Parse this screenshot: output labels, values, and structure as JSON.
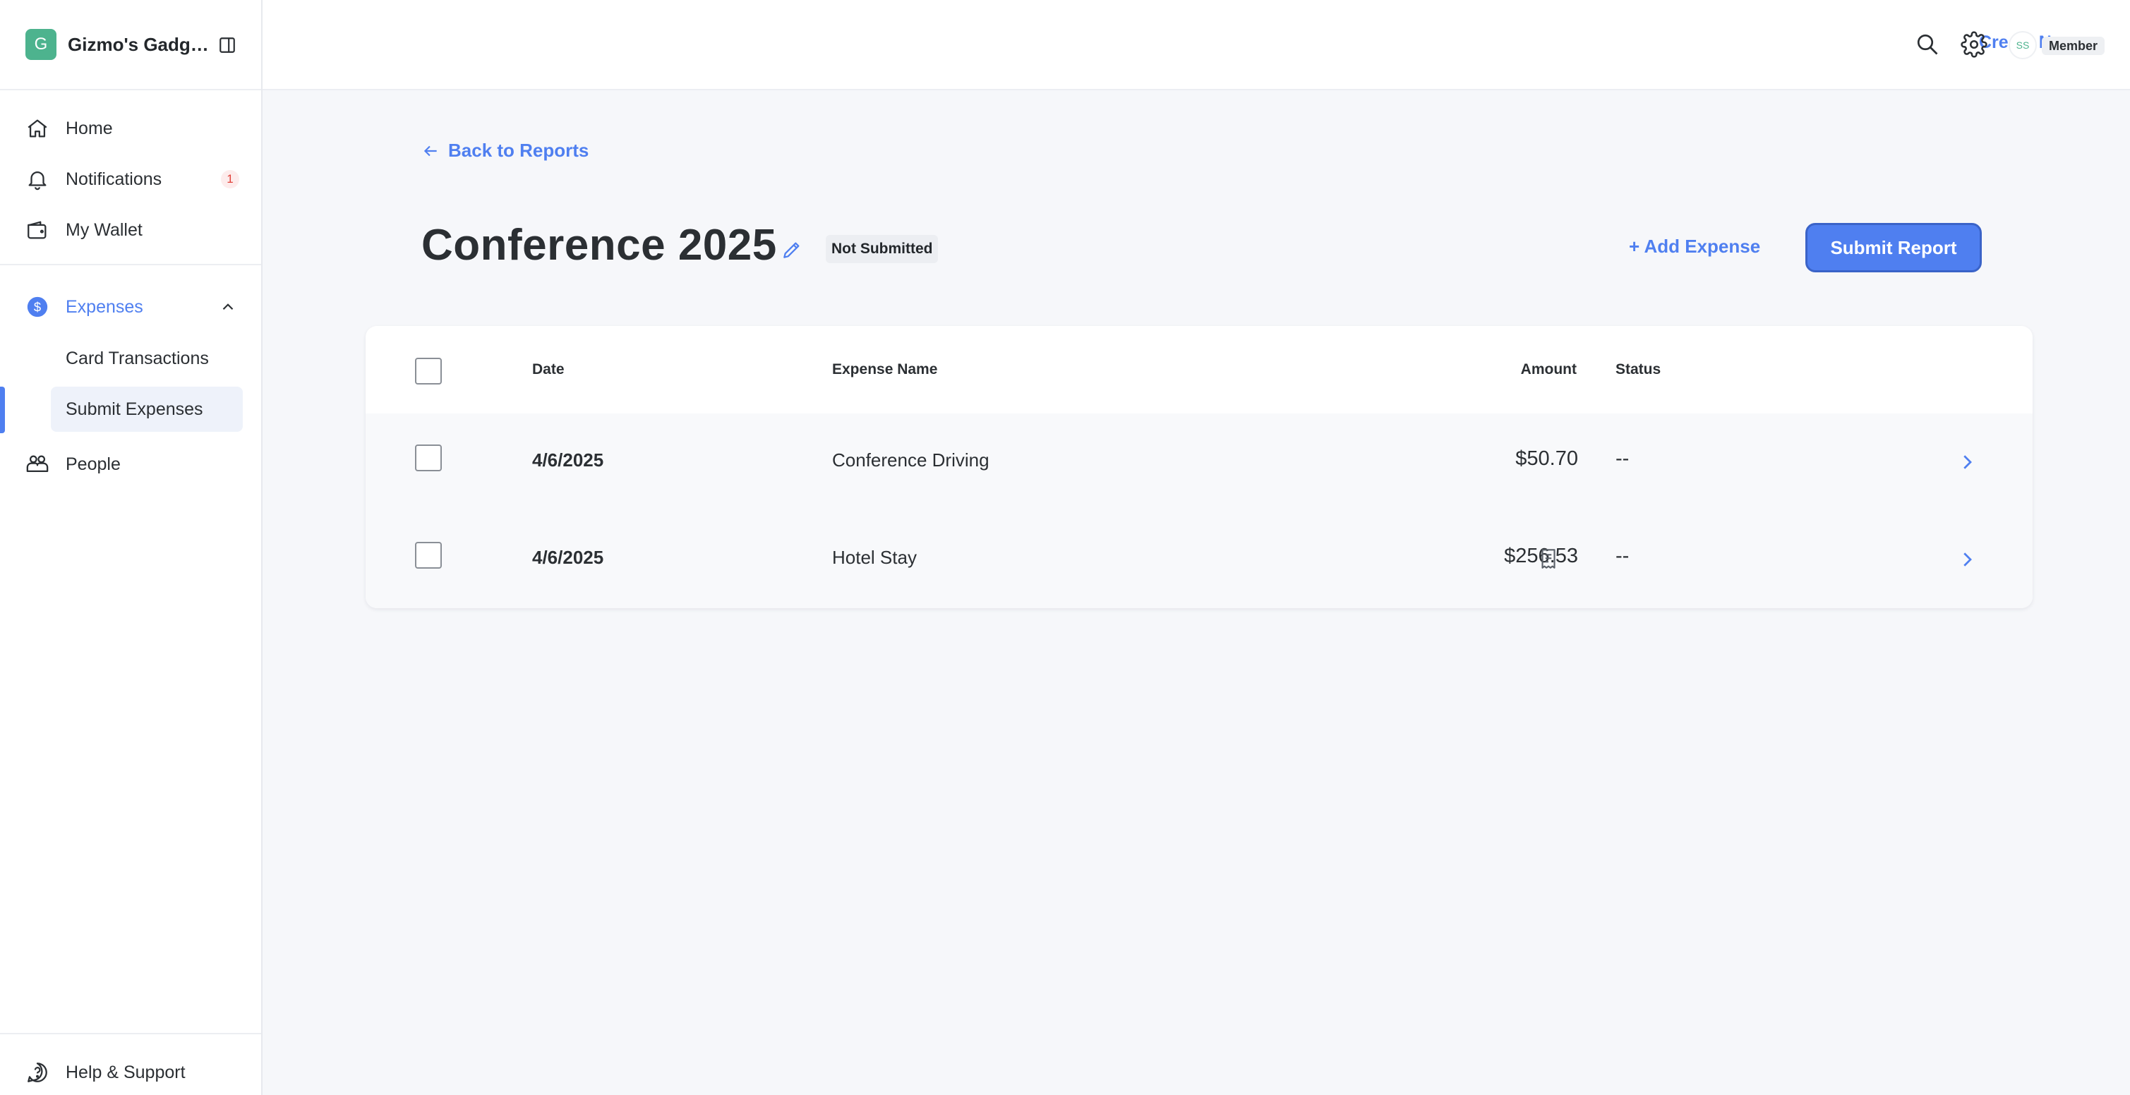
{
  "app": {
    "org_initial": "G",
    "org_name": "Gizmo's Gadgets"
  },
  "sidebar": {
    "items": [
      {
        "label": "Home",
        "icon": "home-icon"
      },
      {
        "label": "Notifications",
        "icon": "bell-icon",
        "badge": "1"
      },
      {
        "label": "My Wallet",
        "icon": "wallet-icon"
      },
      {
        "label": "Expenses",
        "icon": "dollar-icon",
        "expanded": true
      },
      {
        "label": "People",
        "icon": "people-icon"
      }
    ],
    "sub_items": [
      {
        "label": "Card Transactions"
      },
      {
        "label": "Submit Expenses",
        "active": true
      }
    ],
    "footer": {
      "label": "Help & Support",
      "icon": "help-icon"
    }
  },
  "header": {
    "create_new": "Create New +",
    "avatar_initials": "SS",
    "role": "Member"
  },
  "page": {
    "back_link": "Back to Reports",
    "title": "Conference 2025",
    "status": "Not Submitted",
    "add_expense": "+ Add Expense",
    "submit_report": "Submit Report"
  },
  "table": {
    "columns": {
      "date": "Date",
      "name": "Expense Name",
      "amount": "Amount",
      "status": "Status"
    },
    "rows": [
      {
        "date": "4/6/2025",
        "name": "Conference Driving",
        "amount": "$50.70",
        "receipt": false,
        "status": "--"
      },
      {
        "date": "4/6/2025",
        "name": "Hotel Stay",
        "amount": "$256.53",
        "receipt": true,
        "status": "--"
      }
    ]
  },
  "colors": {
    "accent": "#4f7ff0",
    "brand_green": "#4db38e",
    "badge_red": "#e0413a"
  }
}
